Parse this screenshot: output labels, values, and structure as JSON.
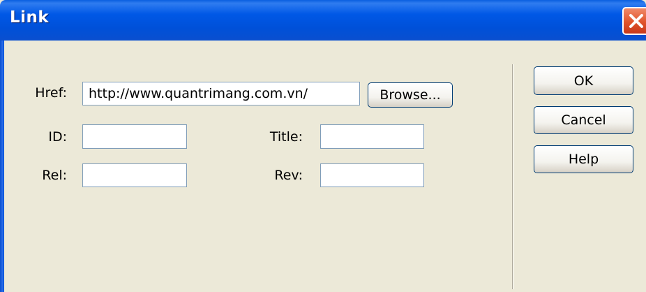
{
  "window": {
    "title": "Link"
  },
  "form": {
    "href_label": "Href:",
    "href_value": "http://www.quantrimang.com.vn/",
    "browse_label": "Browse...",
    "id_label": "ID:",
    "id_value": "",
    "title_label": "Title:",
    "title_value": "",
    "rel_label": "Rel:",
    "rel_value": "",
    "rev_label": "Rev:",
    "rev_value": ""
  },
  "buttons": {
    "ok": "OK",
    "cancel": "Cancel",
    "help": "Help"
  },
  "colors": {
    "titlebar": "#0058E6",
    "dialog_bg": "#ECE9D8",
    "close": "#E0532B",
    "field_border": "#7F9DB9"
  }
}
